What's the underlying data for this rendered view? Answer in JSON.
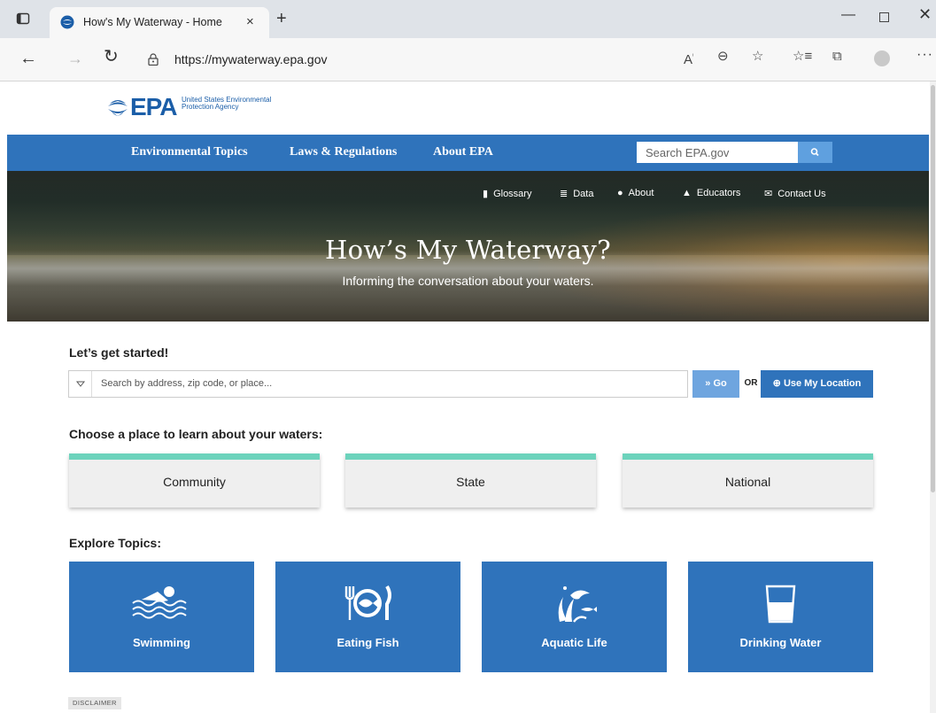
{
  "browser": {
    "tab_title": "How's My Waterway - Home",
    "tab_close": "×",
    "new_tab": "+",
    "url": "https://mywaterway.epa.gov",
    "min": "—",
    "close": "✕",
    "more": "···"
  },
  "epa": {
    "logo_word": "EPA",
    "logo_sub": "United States Environmental Protection Agency",
    "nav": [
      "Environmental Topics",
      "Laws & Regulations",
      "About EPA"
    ],
    "search_placeholder": "Search EPA.gov"
  },
  "hero": {
    "links": [
      {
        "label": "Glossary",
        "icon": "book-icon"
      },
      {
        "label": "Data",
        "icon": "database-icon"
      },
      {
        "label": "About",
        "icon": "info-icon"
      },
      {
        "label": "Educators",
        "icon": "graduation-cap-icon"
      },
      {
        "label": "Contact Us",
        "icon": "envelope-icon"
      }
    ],
    "title": "How’s My Waterway?",
    "subtitle": "Informing the conversation about your waters."
  },
  "search": {
    "heading": "Let’s get started!",
    "placeholder": "Search by address, zip code, or place...",
    "go_label": "Go",
    "or_label": "OR",
    "location_label": "Use My Location"
  },
  "places": {
    "heading": "Choose a place to learn about your waters:",
    "items": [
      "Community",
      "State",
      "National"
    ]
  },
  "topics": {
    "heading": "Explore Topics:",
    "items": [
      {
        "label": "Swimming",
        "icon": "swimmer-icon"
      },
      {
        "label": "Eating Fish",
        "icon": "fish-plate-icon"
      },
      {
        "label": "Aquatic Life",
        "icon": "aquatic-life-icon"
      },
      {
        "label": "Drinking Water",
        "icon": "water-glass-icon"
      }
    ]
  },
  "footer": {
    "disclaimer": "DISCLAIMER"
  },
  "colors": {
    "epa_blue": "#2f73bb",
    "accent_teal": "#6cd3bc"
  }
}
